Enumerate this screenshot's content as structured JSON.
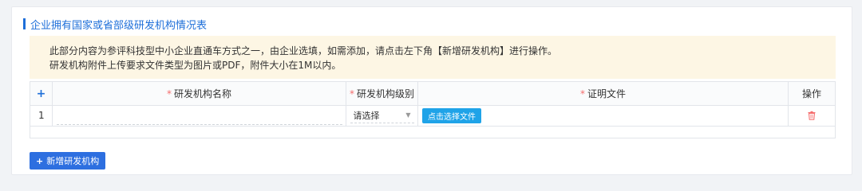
{
  "section": {
    "title": "企业拥有国家或省部级研发机构情况表"
  },
  "notice": {
    "line1": "此部分内容为参评科技型中小企业直通车方式之一，由企业选填，如需添加，请点击左下角【新增研发机构】进行操作。",
    "line2": "研发机构附件上传要求文件类型为图片或PDF，附件大小在1M以内。"
  },
  "table": {
    "headers": {
      "add_icon": "+",
      "name": "研发机构名称",
      "level": "研发机构级别",
      "file": "证明文件",
      "action": "操作"
    },
    "required_mark": "*",
    "rows": [
      {
        "index": "1",
        "name_value": "",
        "level_value": "请选择",
        "file_button": "点击选择文件"
      }
    ]
  },
  "add_button": {
    "icon": "+",
    "label": "新增研发机构"
  },
  "colors": {
    "accent": "#1e6fd9",
    "required": "#f56c6c",
    "notice_bg": "#fdf6e4",
    "file_button": "#1fa3e8",
    "add_button": "#2d6fe0",
    "delete_icon": "#f56c6c"
  },
  "icons": {
    "delete": "trash-icon",
    "dropdown": "caret-down-icon",
    "add": "plus-icon"
  }
}
